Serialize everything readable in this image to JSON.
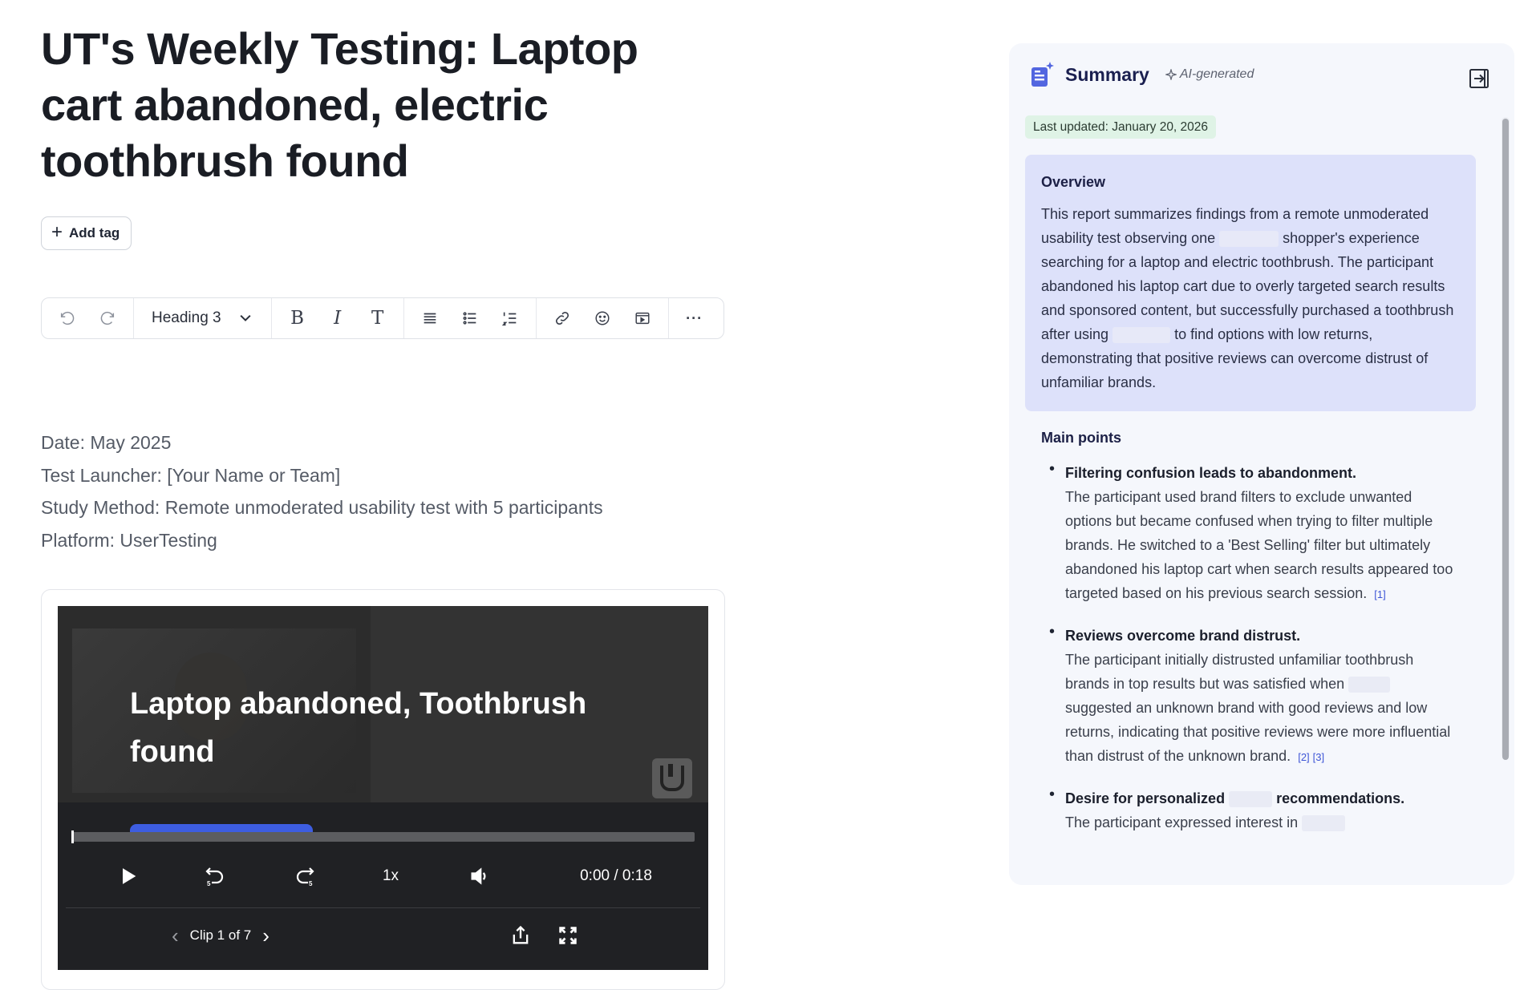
{
  "document": {
    "title": "UT's Weekly Testing: Laptop cart abandoned, electric toothbrush found",
    "add_tag_label": "Add tag"
  },
  "toolbar": {
    "heading_select": "Heading 3",
    "icons": [
      "undo-icon",
      "redo-icon",
      "chevron-down-icon",
      "bold-icon",
      "italic-icon",
      "clear-format-icon",
      "align-icon",
      "bullet-list-icon",
      "numbered-list-icon",
      "link-icon",
      "emoji-icon",
      "embed-video-icon",
      "more-icon"
    ],
    "bold_glyph": "B",
    "italic_glyph": "I",
    "text_glyph": "T",
    "more_glyph": "···"
  },
  "meta": {
    "date": "Date: May 2025",
    "launcher": "Test Launcher: [Your Name or Team]",
    "method": "Study Method: Remote unmoderated usability test with 5 participants",
    "platform": "Platform: UserTesting"
  },
  "video": {
    "caption": "Laptop abandoned, Toothbrush found",
    "speed": "1x",
    "time": "0:00 / 0:18",
    "clip_label": "Clip 1 of 7",
    "progress_fraction": 0.0,
    "skip_seconds": "5"
  },
  "summary": {
    "title": "Summary",
    "ai_label": "AI-generated",
    "last_updated": "Last updated: January 20, 2026",
    "overview_title": "Overview",
    "overview_parts": [
      "This report summarizes findings from a remote unmoderated usability test observing one",
      "shopper's experience searching for a laptop and electric toothbrush. The participant abandoned his laptop cart due to overly targeted search results and sponsored content, but successfully purchased a toothbrush after using",
      "to find options with low returns, demonstrating that positive reviews can overcome distrust of unfamiliar brands."
    ],
    "main_points_title": "Main points",
    "points": [
      {
        "head": "Filtering confusion leads to abandonment.",
        "body": "The participant used brand filters to exclude unwanted options but became confused when trying to filter multiple brands. He switched to a 'Best Selling' filter but ultimately abandoned his laptop cart when search results appeared too targeted based on his previous search session.",
        "cites": [
          "[1]"
        ]
      },
      {
        "head": "Reviews overcome brand distrust.",
        "body_parts": [
          "The participant initially distrusted unfamiliar toothbrush brands in top results but was satisfied when",
          "suggested an unknown brand with good reviews and low returns, indicating that positive reviews were more influential than distrust of the unknown brand."
        ],
        "cites": [
          "[2]",
          "[3]"
        ]
      },
      {
        "head_parts": [
          "Desire for personalized",
          "recommendations."
        ],
        "body": "The participant expressed interest in"
      }
    ]
  }
}
